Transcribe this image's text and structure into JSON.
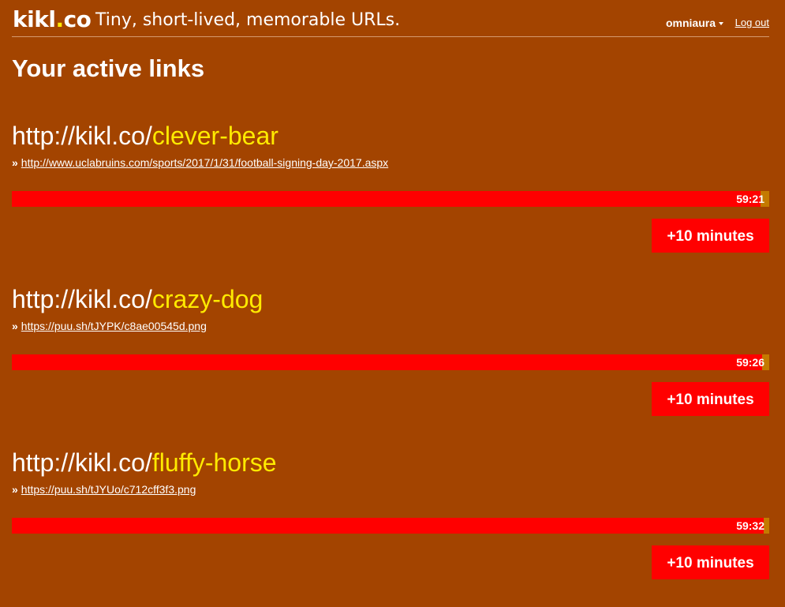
{
  "header": {
    "logo_name": "kikl",
    "logo_dot": ".",
    "logo_tld": "co",
    "tagline": "Tiny, short-lived, memorable URLs.",
    "username": "omniaura",
    "logout_label": "Log out"
  },
  "page_title": "Your active links",
  "links": [
    {
      "prefix": "http://kikl.co/",
      "slug": "clever-bear",
      "arrow": "»",
      "destination": "http://www.uclabruins.com/sports/2017/1/31/football-signing-day-2017.aspx",
      "time_left": "59:21",
      "remaining_fraction": 0.989,
      "extend_label": "+10 minutes"
    },
    {
      "prefix": "http://kikl.co/",
      "slug": "crazy-dog",
      "arrow": "»",
      "destination": "https://puu.sh/tJYPK/c8ae00545d.png",
      "time_left": "59:26",
      "remaining_fraction": 0.991,
      "extend_label": "+10 minutes"
    },
    {
      "prefix": "http://kikl.co/",
      "slug": "fluffy-horse",
      "arrow": "»",
      "destination": "https://puu.sh/tJYUo/c712cff3f3.png",
      "time_left": "59:32",
      "remaining_fraction": 0.993,
      "extend_label": "+10 minutes"
    }
  ],
  "colors": {
    "background": "#a34400",
    "accent": "#ffea00",
    "timer_bar": "#ff0000",
    "timer_track": "#c47a00",
    "button": "#ff0000"
  }
}
